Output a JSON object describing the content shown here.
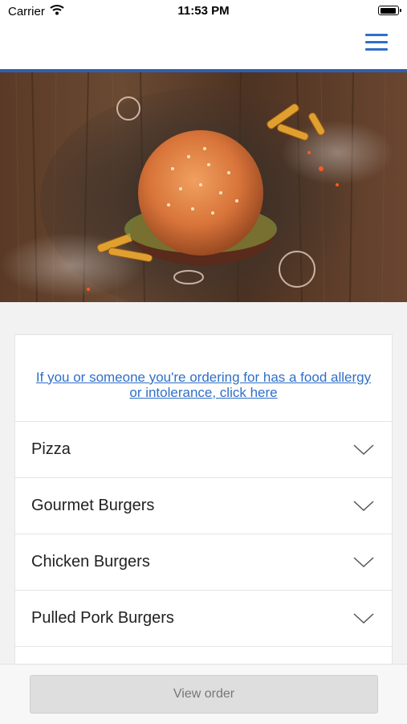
{
  "status_bar": {
    "carrier": "Carrier",
    "time": "11:53 PM"
  },
  "header": {
    "menu_icon": "hamburger-menu-icon",
    "accent_color": "#2f5fb3"
  },
  "allergy_link": "If you or someone you're ordering for has a food allergy or intolerance, click here",
  "categories": [
    {
      "label": "Pizza"
    },
    {
      "label": "Gourmet Burgers"
    },
    {
      "label": "Chicken Burgers"
    },
    {
      "label": "Pulled Pork Burgers"
    },
    {
      "label": ""
    }
  ],
  "footer": {
    "view_order_label": "View order"
  }
}
